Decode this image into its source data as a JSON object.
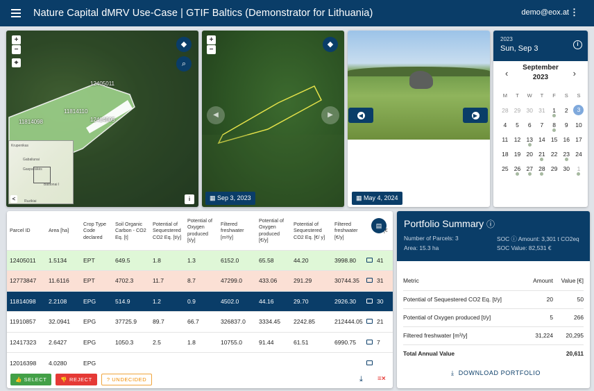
{
  "header": {
    "title": "Nature Capital dMRV Use-Case | GTIF Baltics (Demonstrator for Lithuania)",
    "user": "demo@eox.at",
    "menu_icon": "hamburger-icon",
    "kebab": "⋮"
  },
  "map1": {
    "zoom_in": "+",
    "zoom_out": "−",
    "locate": "⌖",
    "info": "i",
    "parcel_labels": [
      "12405011",
      "11814110",
      "11814098",
      "12414005"
    ],
    "overview_labels": [
      "Krupenikas",
      "Gabaliunai",
      "Gaspariskės",
      "Bastonai I",
      "Ruzikiai"
    ],
    "overview_collapse": "<"
  },
  "map2": {
    "zoom_in": "+",
    "zoom_out": "−",
    "date": "Sep 3, 2023",
    "prev": "◀",
    "next": "▶"
  },
  "photo": {
    "date": "May 4, 2024",
    "prev": "◀",
    "next": "▶"
  },
  "calendar": {
    "year": "2023",
    "date": "Sun, Sep 3",
    "month": "September",
    "month_year": "2023",
    "weekdays": [
      "M",
      "T",
      "W",
      "T",
      "F",
      "S",
      "S"
    ],
    "weeks": [
      [
        {
          "d": "28",
          "m": true
        },
        {
          "d": "29",
          "m": true
        },
        {
          "d": "30",
          "m": true
        },
        {
          "d": "31",
          "m": true
        },
        {
          "d": "1",
          "dot": true
        },
        {
          "d": "2"
        },
        {
          "d": "3",
          "sel": true
        }
      ],
      [
        {
          "d": "4"
        },
        {
          "d": "5"
        },
        {
          "d": "6"
        },
        {
          "d": "7"
        },
        {
          "d": "8",
          "dot": true
        },
        {
          "d": "9"
        },
        {
          "d": "10"
        }
      ],
      [
        {
          "d": "11"
        },
        {
          "d": "12"
        },
        {
          "d": "13",
          "dot": true
        },
        {
          "d": "14"
        },
        {
          "d": "15"
        },
        {
          "d": "16"
        },
        {
          "d": "17"
        }
      ],
      [
        {
          "d": "18"
        },
        {
          "d": "19"
        },
        {
          "d": "20"
        },
        {
          "d": "21",
          "dot": true
        },
        {
          "d": "22"
        },
        {
          "d": "23",
          "dot": true
        },
        {
          "d": "24"
        }
      ],
      [
        {
          "d": "25"
        },
        {
          "d": "26",
          "dot": true
        },
        {
          "d": "27",
          "dot": true
        },
        {
          "d": "28",
          "dot": true
        },
        {
          "d": "29"
        },
        {
          "d": "30"
        },
        {
          "d": "1",
          "m": true,
          "dot": true
        }
      ]
    ]
  },
  "table": {
    "columns": [
      "Parcel ID",
      "Area [ha]",
      "Crop Type Code declared",
      "Soil Organic Carbon - CO2 Eq. [t]",
      "Potential of Sequestered CO2 Eq. [t/y]",
      "Potential of Oxygen produced [t/y]",
      "Filtered freshwater [m³/y]",
      "Potential of Oxygen produced [€/y]",
      "Potential of Sequestered CO2 Eq. [€/ y]",
      "Filtered freshwater [€/y]",
      "",
      "To [€"
    ],
    "rows": [
      {
        "cls": "green",
        "cells": [
          "12405011",
          "1.5134",
          "EPT",
          "649.5",
          "1.8",
          "1.3",
          "6152.0",
          "65.58",
          "44.20",
          "3998.80",
          "",
          "41"
        ]
      },
      {
        "cls": "pink",
        "cells": [
          "12773847",
          "11.6116",
          "EPT",
          "4702.3",
          "11.7",
          "8.7",
          "47299.0",
          "433.06",
          "291.29",
          "30744.35",
          "",
          "31"
        ]
      },
      {
        "cls": "blue",
        "cells": [
          "11814098",
          "2.2108",
          "EPG",
          "514.9",
          "1.2",
          "0.9",
          "4502.0",
          "44.16",
          "29.70",
          "2926.30",
          "",
          "30"
        ]
      },
      {
        "cls": "",
        "cells": [
          "11910857",
          "32.0941",
          "EPG",
          "37725.9",
          "89.7",
          "66.7",
          "326837.0",
          "3334.45",
          "2242.85",
          "212444.05",
          "",
          "21"
        ]
      },
      {
        "cls": "",
        "cells": [
          "12417323",
          "2.6427",
          "EPG",
          "1050.3",
          "2.5",
          "1.8",
          "10755.0",
          "91.44",
          "61.51",
          "6990.75",
          "",
          "7"
        ]
      },
      {
        "cls": "",
        "cells": [
          "12016398",
          "4.0280",
          "EPG",
          "",
          "",
          "",
          "",
          "",
          "",
          "",
          "",
          ""
        ]
      }
    ],
    "select_label": "SELECT",
    "reject_label": "REJECT",
    "undecided_label": "UNDECIDED"
  },
  "portfolio": {
    "title": "Portfolio Summary",
    "parcels": "Number of Parcels: 3",
    "area": "Area: 15.3 ha",
    "soc_amount": "SOC ⓘ Amount: 3,301 t CO2eq",
    "soc_value": "SOC Value: 82,531 €",
    "headers": [
      "Metric",
      "Amount",
      "Value [€]"
    ],
    "rows": [
      [
        "Potential of Sequestered CO2 Eq. [t/y]",
        "20",
        "50"
      ],
      [
        "Potential of Oxygen produced [t/y]",
        "5",
        "266"
      ],
      [
        "Filtered freshwater [m³/y]",
        "31,224",
        "20,295"
      ],
      [
        "Total Annual Value",
        "",
        "20,611"
      ]
    ],
    "download_label": "DOWNLOAD PORTFOLIO"
  }
}
